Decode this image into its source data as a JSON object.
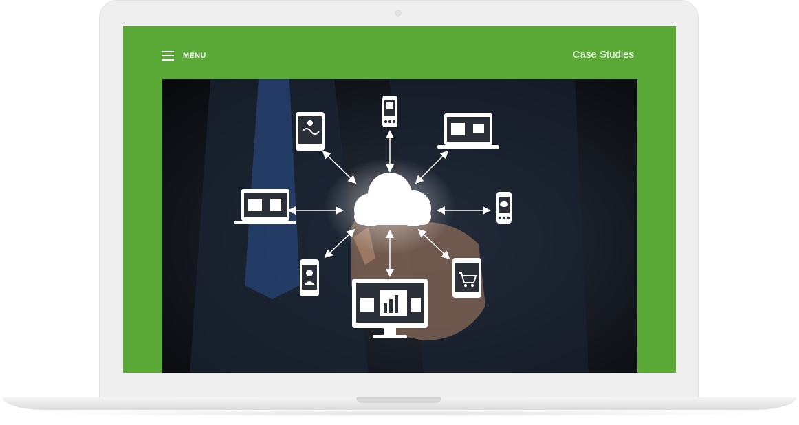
{
  "header": {
    "menu_label": "MENU",
    "case_studies_label": "Case Studies"
  },
  "colors": {
    "brand_green": "#5aa836",
    "device_frame": "#efefef",
    "icon_white": "#ffffff"
  },
  "hero": {
    "icons": [
      "cloud-icon",
      "smartphone-qr-icon",
      "tablet-map-icon",
      "laptop-map-video-icon",
      "laptop-shop-user-icon",
      "smartphone-chat-icon",
      "smartphone-user-icon",
      "tablet-cart-icon",
      "monitor-analytics-icon"
    ]
  }
}
